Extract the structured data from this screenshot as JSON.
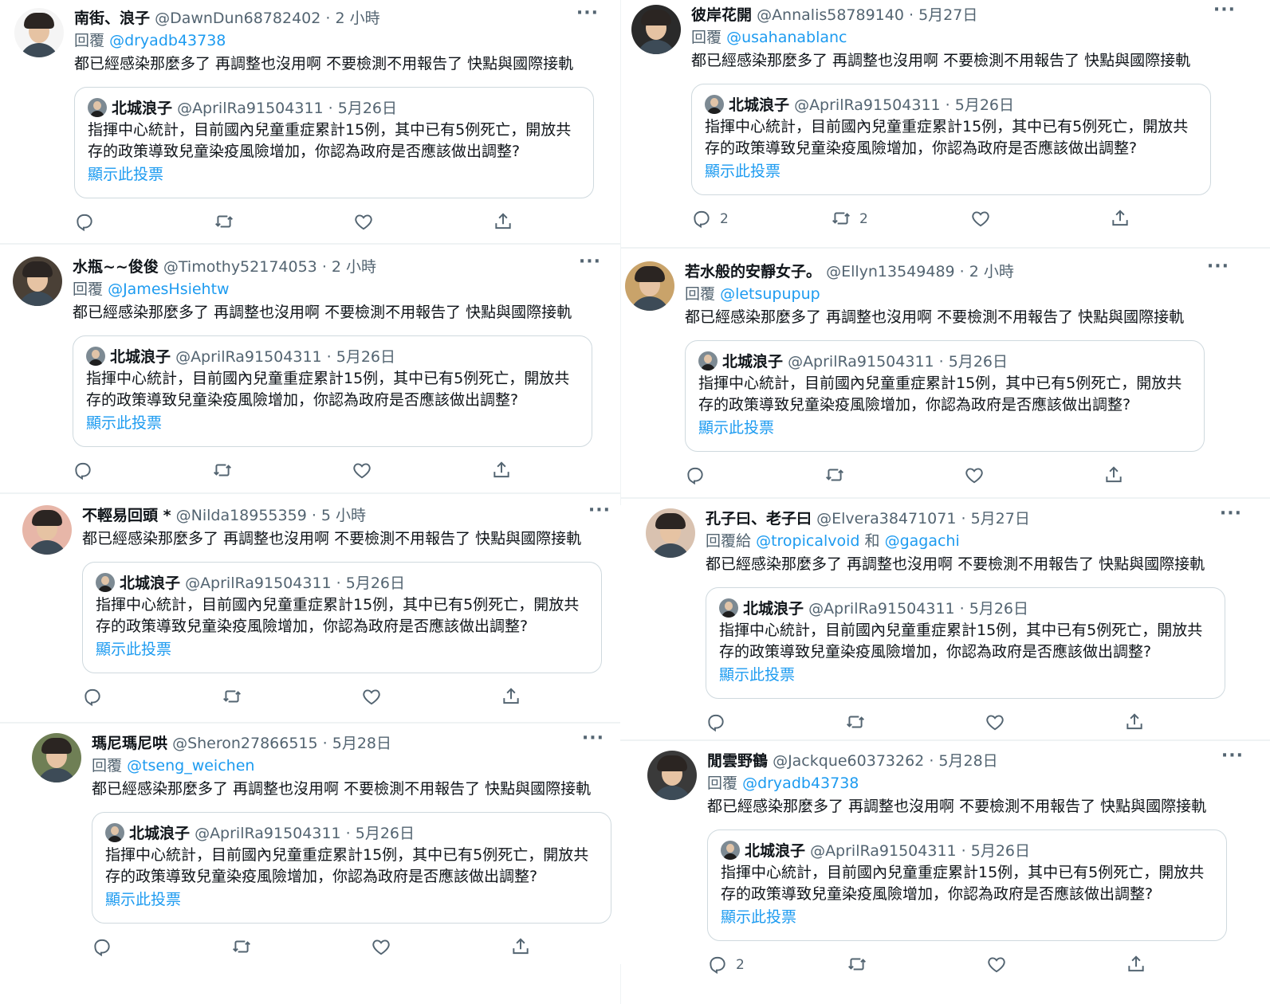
{
  "quoted": {
    "name": "北城浪子",
    "handle": "@AprilRa91504311",
    "time": "· 5月26日",
    "text": "指揮中心統計，目前國內兒童重症累計15例，其中已有5例死亡，開放共存的政策導致兒童染疫風險增加，你認為政府是否應該做出調整?",
    "show_poll": "顯示此投票"
  },
  "tweets": [
    {
      "name": "南街、浪子",
      "handle": "@DawnDun68782402",
      "time": "· 2 小時",
      "reply_prefix": "回覆",
      "reply_to": "@dryadb43738",
      "reply_and": "",
      "reply_to2": "",
      "text": "都已經感染那麼多了 再調整也沒用啊 不要檢測不用報告了 快點與國際接軌",
      "reply_count": "",
      "retweet_count": "",
      "avatar_color": "#f5f5f5"
    },
    {
      "name": "彼岸花開",
      "handle": "@Annalis58789140",
      "time": "· 5月27日",
      "reply_prefix": "回覆",
      "reply_to": "@usahanablanc",
      "reply_and": "",
      "reply_to2": "",
      "text": "都已經感染那麼多了 再調整也沒用啊 不要檢測不用報告了 快點與國際接軌",
      "reply_count": "2",
      "retweet_count": "2",
      "avatar_color": "#2a2a2a"
    },
    {
      "name": "水瓶~~俊俊",
      "handle": "@Timothy52174053",
      "time": "· 2 小時",
      "reply_prefix": "回覆",
      "reply_to": "@JamesHsiehtw",
      "reply_and": "",
      "reply_to2": "",
      "text": "都已經感染那麼多了 再調整也沒用啊 不要檢測不用報告了 快點與國際接軌",
      "reply_count": "",
      "retweet_count": "",
      "avatar_color": "#4a4036"
    },
    {
      "name": "若水般的安靜女子。",
      "handle": "@Ellyn13549489",
      "time": "· 2 小時",
      "reply_prefix": "回覆",
      "reply_to": "@letsupupup",
      "reply_and": "",
      "reply_to2": "",
      "text": "都已經感染那麼多了 再調整也沒用啊 不要檢測不用報告了 快點與國際接軌",
      "reply_count": "",
      "retweet_count": "",
      "avatar_color": "#c9a36a"
    },
    {
      "name": "不輕易回頭 *",
      "handle": "@Nilda18955359",
      "time": "· 5 小時",
      "reply_prefix": "",
      "reply_to": "",
      "reply_and": "",
      "reply_to2": "",
      "text": "都已經感染那麼多了 再調整也沒用啊 不要檢測不用報告了 快點與國際接軌",
      "reply_count": "",
      "retweet_count": "",
      "avatar_color": "#e7b6a8"
    },
    {
      "name": "孔子曰、老子曰",
      "handle": "@Elvera38471071",
      "time": "· 5月27日",
      "reply_prefix": "回覆給",
      "reply_to": "@tropicalvoid",
      "reply_and": "和",
      "reply_to2": "@gagachi",
      "text": "都已經感染那麼多了 再調整也沒用啊 不要檢測不用報告了 快點與國際接軌",
      "reply_count": "",
      "retweet_count": "",
      "avatar_color": "#d9c2b0"
    },
    {
      "name": "瑪尼瑪尼哄",
      "handle": "@Sheron27866515",
      "time": "· 5月28日",
      "reply_prefix": "回覆",
      "reply_to": "@tseng_weichen",
      "reply_and": "",
      "reply_to2": "",
      "text": "都已經感染那麼多了 再調整也沒用啊 不要檢測不用報告了 快點與國際接軌",
      "reply_count": "",
      "retweet_count": "",
      "avatar_color": "#6f7f55"
    },
    {
      "name": "閒雲野鶴",
      "handle": "@Jackque60373262",
      "time": "· 5月28日",
      "reply_prefix": "回覆",
      "reply_to": "@dryadb43738",
      "reply_and": "",
      "reply_to2": "",
      "text": "都已經感染那麼多了 再調整也沒用啊 不要檢測不用報告了 快點與國際接軌",
      "reply_count": "2",
      "retweet_count": "",
      "avatar_color": "#3a3a3a"
    }
  ],
  "icons": {
    "more": "more-icon",
    "reply": "reply-icon",
    "retweet": "retweet-icon",
    "like": "like-icon",
    "share": "share-icon"
  }
}
